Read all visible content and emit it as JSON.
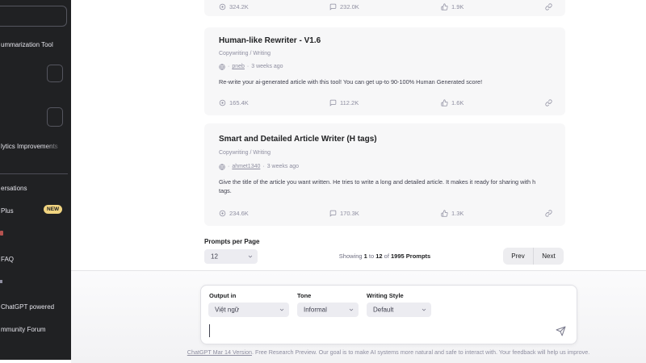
{
  "sidebar": {
    "conversation_1": "ummarization Tool",
    "conversation_2": "lytics Improvements",
    "clear_conversations": "ersations",
    "upgrade": {
      "label": "Plus",
      "badge": "NEW"
    },
    "faq": "FAQ",
    "powered": "ChatGPT powered",
    "community": "mmunity Forum"
  },
  "prompt_list": {
    "top_card_stats": {
      "views": "324.2K",
      "comments": "232.0K",
      "likes": "1.9K"
    },
    "cards": [
      {
        "title": "Human-like Rewriter - V1.6",
        "category": "Copywriting / Writing",
        "dot": "·",
        "author": "pneb",
        "age": "3 weeks ago",
        "description": "Re-write your ai-generated article with this tool! You can get up-to 90-100% Human Generated score!",
        "views": "165.4K",
        "comments": "112.2K",
        "likes": "1.6K"
      },
      {
        "title": "Smart and Detailed Article Writer (H tags)",
        "category": "Copywriting / Writing",
        "dot": "·",
        "author": "ahmet1340",
        "age": "3 weeks ago",
        "description": "Give the title of the article you want written. He tries to write a long and detailed article. It makes it ready for sharing with h tags.",
        "views": "234.6K",
        "comments": "170.3K",
        "likes": "1.3K"
      }
    ]
  },
  "pagination": {
    "per_page_label": "Prompts per Page",
    "per_page_value": "12",
    "showing_prefix": "Showing ",
    "from": "1",
    "to_word": " to ",
    "to": "12",
    "of_word": " of ",
    "total": "1995 Prompts",
    "prev": "Prev",
    "next": "Next"
  },
  "chat_controls": {
    "output_in_label": "Output in",
    "output_in_value": "Việt ngữ",
    "tone_label": "Tone",
    "tone_value": "Informal",
    "style_label": "Writing Style",
    "style_value": "Default"
  },
  "footer": {
    "link": "ChatGPT Mar 14 Version",
    "text": ". Free Research Preview. Our goal is to make AI systems more natural and safe to interact with. Your feedback will help us improve."
  },
  "colors": {
    "sidebar_bg": "#202123",
    "card_bg": "#f7f7f8",
    "badge_yellow": "#f1d480",
    "muted_text": "#8e8ea0"
  }
}
